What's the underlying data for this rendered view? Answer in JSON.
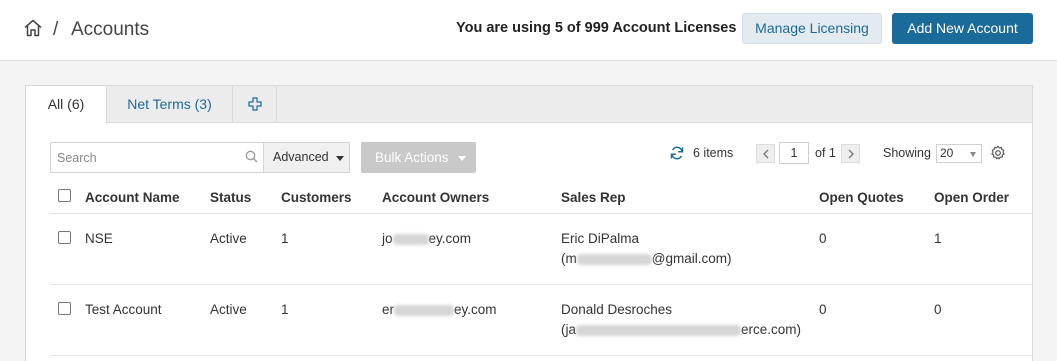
{
  "header": {
    "breadcrumb_separator": "/",
    "page_title": "Accounts",
    "license_text": "You are using 5 of 999 Account Licenses",
    "manage_licensing_label": "Manage Licensing",
    "add_account_label": "Add New Account"
  },
  "tabs": {
    "all_label": "All (6)",
    "net_terms_label": "Net Terms (3)"
  },
  "toolbar": {
    "search_placeholder": "Search",
    "advanced_label": "Advanced",
    "bulk_actions_label": "Bulk Actions",
    "items_count": "6 items",
    "current_page": "1",
    "page_total": "of 1",
    "showing_label": "Showing",
    "page_size": "20"
  },
  "columns": {
    "account_name": "Account Name",
    "status": "Status",
    "customers": "Customers",
    "account_owners": "Account Owners",
    "sales_rep": "Sales Rep",
    "open_quotes": "Open Quotes",
    "open_orders": "Open Order"
  },
  "rows": [
    {
      "account_name": "NSE",
      "status": "Active",
      "customers": "1",
      "owner_prefix": "jo",
      "owner_suffix": "ey.com",
      "sales_rep_name": "Eric DiPalma",
      "sales_rep_email_prefix": "(m",
      "sales_rep_email_suffix": "@gmail.com)",
      "open_quotes": "0",
      "open_orders": "1"
    },
    {
      "account_name": "Test Account",
      "status": "Active",
      "customers": "1",
      "owner_prefix": "er",
      "owner_suffix": "ey.com",
      "sales_rep_name": "Donald Desroches",
      "sales_rep_email_prefix": "(ja",
      "sales_rep_email_suffix": "erce.com)",
      "open_quotes": "0",
      "open_orders": "0"
    }
  ],
  "colors": {
    "primary": "#1a6a9a",
    "link": "#1b6a9a",
    "disabled": "#c9c9c9"
  }
}
